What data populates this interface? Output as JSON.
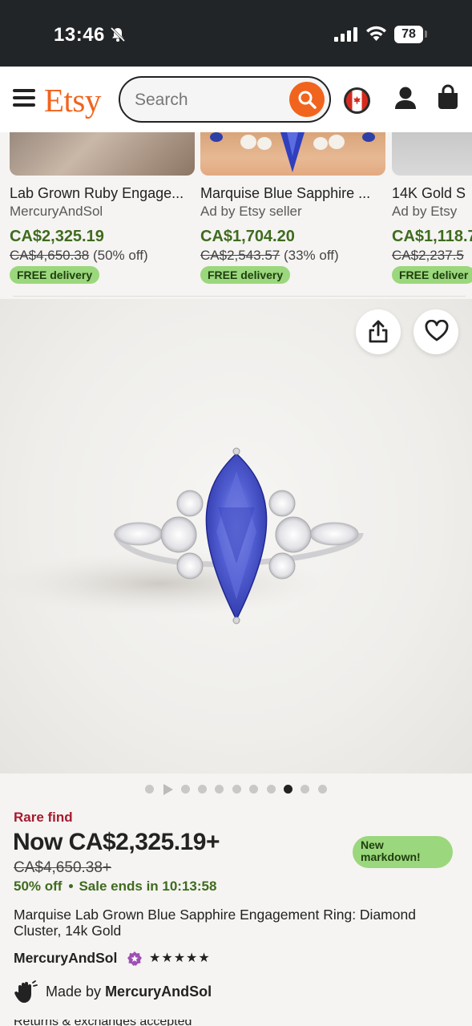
{
  "status_bar": {
    "time": "13:46",
    "battery": "78"
  },
  "header": {
    "logo": "Etsy",
    "search_placeholder": "Search"
  },
  "related_items": [
    {
      "title": "Lab Grown Ruby Engage...",
      "seller": "MercuryAndSol",
      "price": "CA$2,325.19",
      "original_price": "CA$4,650.38",
      "discount": "(50% off)",
      "badge": "FREE delivery"
    },
    {
      "title": "Marquise Blue Sapphire ...",
      "seller": "Ad by Etsy seller",
      "price": "CA$1,704.20",
      "original_price": "CA$2,543.57",
      "discount": "(33% off)",
      "badge": "FREE delivery"
    },
    {
      "title": "14K Gold S",
      "seller": "Ad by Etsy",
      "price": "CA$1,118.7",
      "original_price": "CA$2,237.5",
      "discount": "",
      "badge": "FREE deliver"
    }
  ],
  "gallery": {
    "total_dots": 10,
    "active_index": 8
  },
  "listing": {
    "rare_label": "Rare find",
    "now_price": "Now CA$2,325.19+",
    "was_price": "CA$4,650.38+",
    "discount": "50% off",
    "sale_ends": "Sale ends in 10:13:58",
    "markdown_badge_line1": "New",
    "markdown_badge_line2": "markdown!",
    "title": "Marquise Lab Grown Blue Sapphire Engagement Ring: Diamond Cluster, 14k Gold",
    "shop_name": "MercuryAndSol",
    "rating_stars": "★★★★★",
    "made_by_prefix": "Made by",
    "made_by_shop": "MercuryAndSol",
    "next_line_partial": "Returns & exchanges accepted"
  },
  "colors": {
    "brand": "#f1641e",
    "sale_green": "#3f6b1f",
    "badge_green": "#9bd77c",
    "rare_red": "#a61a2e"
  }
}
